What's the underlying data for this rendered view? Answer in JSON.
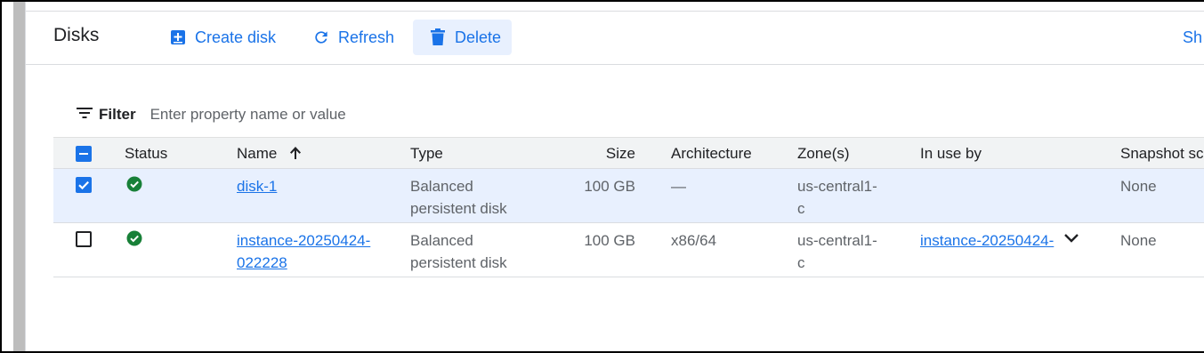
{
  "header": {
    "title": "Disks",
    "create_label": "Create disk",
    "refresh_label": "Refresh",
    "delete_label": "Delete",
    "show_label": "Sh"
  },
  "filter": {
    "label": "Filter",
    "placeholder": "Enter property name or value"
  },
  "table": {
    "columns": {
      "status": "Status",
      "name": "Name",
      "type": "Type",
      "size": "Size",
      "architecture": "Architecture",
      "zones": "Zone(s)",
      "in_use_by": "In use by",
      "snapshot": "Snapshot sc"
    },
    "rows": [
      {
        "selected": true,
        "status": "ok",
        "name": "disk-1",
        "type_line1": "Balanced",
        "type_line2": "persistent disk",
        "size": "100 GB",
        "architecture": "—",
        "zone_line1": "us-central1-",
        "zone_line2": "c",
        "in_use_by": "",
        "snapshot": "None"
      },
      {
        "selected": false,
        "status": "ok",
        "name_line1": "instance-20250424-",
        "name_line2": "022228",
        "type_line1": "Balanced",
        "type_line2": "persistent disk",
        "size": "100 GB",
        "architecture": "x86/64",
        "zone_line1": "us-central1-",
        "zone_line2": "c",
        "in_use_by": "instance-20250424-",
        "snapshot": "None"
      }
    ]
  },
  "colors": {
    "accent": "#1a73e8",
    "status_ok": "#188038",
    "selected_row": "#e8f0fe",
    "header_row": "#f1f3f4"
  },
  "icons": {
    "create": "add-box-icon",
    "refresh": "refresh-icon",
    "delete": "trash-icon",
    "filter": "filter-list-icon",
    "sort": "arrow-up-icon",
    "status": "check-circle-icon",
    "expand": "chevron-down-icon"
  }
}
